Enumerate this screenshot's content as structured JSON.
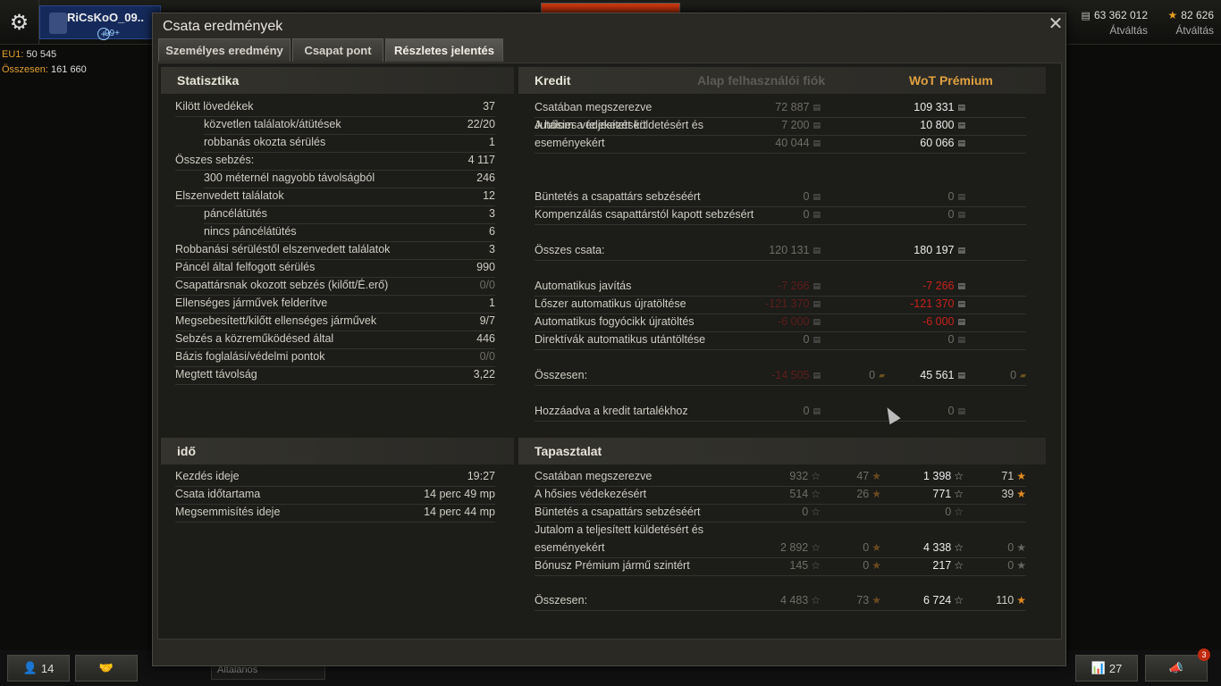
{
  "topbar": {
    "player_name": "RiCsKoO_09..",
    "badge": "99+",
    "server_label": "EU1:",
    "server_value": "50 545",
    "total_label": "Összesen:",
    "total_value": "161 660",
    "credits": "63 362 012",
    "credits_label": "Átváltás",
    "gold": "82 626",
    "gold_label": "Átváltás"
  },
  "bottombar": {
    "friends": "14",
    "channel": "Általános",
    "stats": "27",
    "notif": "3"
  },
  "dialog": {
    "title": "Csata eredmények",
    "tabs": [
      "Személyes eredmény",
      "Csapat pont",
      "Részletes jelentés"
    ]
  },
  "stats": {
    "header": "Statisztika",
    "rows": [
      {
        "label": "Kilött lövedékek",
        "value": "37",
        "indent": false
      },
      {
        "label": "közvetlen találatok/átütések",
        "value": "22/20",
        "indent": true
      },
      {
        "label": "robbanás okozta sérülés",
        "value": "1",
        "indent": true
      },
      {
        "label": "Összes sebzés:",
        "value": "4 117",
        "indent": false
      },
      {
        "label": "300 méternél nagyobb távolságból",
        "value": "246",
        "indent": true
      },
      {
        "label": "Elszenvedett találatok",
        "value": "12",
        "indent": false
      },
      {
        "label": "páncélátütés",
        "value": "3",
        "indent": true
      },
      {
        "label": "nincs páncélátütés",
        "value": "6",
        "indent": true
      },
      {
        "label": "Robbanási sérüléstől elszenvedett találatok",
        "value": "3",
        "indent": false
      },
      {
        "label": "Páncél által felfogott sérülés",
        "value": "990",
        "indent": false
      },
      {
        "label": "Csapattársnak okozott sebzés (kilőtt/É.erő)",
        "value": "0/0",
        "indent": false,
        "dim": true
      },
      {
        "label": "Ellenséges járművek felderítve",
        "value": "1",
        "indent": false
      },
      {
        "label": "Megsebesített/kilőtt ellenséges járművek",
        "value": "9/7",
        "indent": false
      },
      {
        "label": "Sebzés a közreműködésed által",
        "value": "446",
        "indent": false
      },
      {
        "label": "Bázis foglalási/védelmi pontok",
        "value": "0/0",
        "indent": false,
        "dim": true
      },
      {
        "label": "Megtett távolság",
        "value": "3,22",
        "indent": false
      }
    ]
  },
  "time": {
    "header": "idő",
    "rows": [
      {
        "label": "Kezdés ideje",
        "value": "19:27"
      },
      {
        "label": "Csata időtartama",
        "value": "14 perc 49 mp"
      },
      {
        "label": "Megsemmisítés ideje",
        "value": "14 perc 44 mp"
      }
    ]
  },
  "credit": {
    "header": "Kredit",
    "col_basic": "Alap felhasználói fiók",
    "col_premium": "WoT Prémium",
    "rows": [
      {
        "label": "Csatában megszerezve",
        "basic": "72 887",
        "premium": "109 331"
      },
      {
        "label": "A hősies védekezésért",
        "basic": "7 200",
        "premium": "10 800"
      },
      {
        "label": "Jutalom a teljesített küldetésért és",
        "label2": "eseményekért",
        "basic": "40 044",
        "premium": "60 066"
      },
      {
        "label": "Büntetés a csapattárs sebzéséért",
        "basic": "0",
        "premium": "0",
        "dimprem": true
      },
      {
        "label": "Kompenzálás csapattárstól kapott sebzésért",
        "basic": "0",
        "premium": "0",
        "dimprem": true
      },
      {
        "label": "Összes csata:",
        "basic": "120 131",
        "premium": "180 197"
      },
      {
        "label": "Automatikus javítás",
        "basic": "-7 266",
        "premium": "-7 266",
        "neg": true
      },
      {
        "label": "Lőszer automatikus újratöltése",
        "basic": "-121 370",
        "premium": "-121 370",
        "neg": true
      },
      {
        "label": "Automatikus fogyócikk újratöltés",
        "basic": "-6 000",
        "premium": "-6 000",
        "neg": true
      },
      {
        "label": "Direktívák automatikus utántöltése",
        "basic": "0",
        "premium": "0",
        "dimprem": true
      },
      {
        "label": "Összesen:",
        "basic": "-14 505",
        "basic_gold": "0",
        "premium": "45 561",
        "premium_gold": "0",
        "negbasic": true
      },
      {
        "label": "Hozzáadva a kredit tartalékhoz",
        "basic": "0",
        "premium": "0",
        "dimprem": true
      }
    ]
  },
  "xp": {
    "header": "Tapasztalat",
    "rows": [
      {
        "label": "Csatában megszerezve",
        "basic": "932",
        "basic_free": "47",
        "premium": "1 398",
        "premium_free": "71"
      },
      {
        "label": "A hősies védekezésért",
        "basic": "514",
        "basic_free": "26",
        "premium": "771",
        "premium_free": "39"
      },
      {
        "label": "Büntetés a csapattárs sebzéséért",
        "basic": "0",
        "basic_free": "",
        "premium": "0",
        "premium_free": "",
        "dimprem": true
      },
      {
        "label": "Jutalom a teljesített küldetésért és",
        "label2": "eseményekért",
        "basic": "2 892",
        "basic_free": "0",
        "premium": "4 338",
        "premium_free": "0"
      },
      {
        "label": "Bónusz Prémium jármű szintért",
        "basic": "145",
        "basic_free": "0",
        "premium": "217",
        "premium_free": "0"
      },
      {
        "label": "Összesen:",
        "basic": "4 483",
        "basic_free": "73",
        "premium": "6 724",
        "premium_free": "110"
      }
    ]
  }
}
